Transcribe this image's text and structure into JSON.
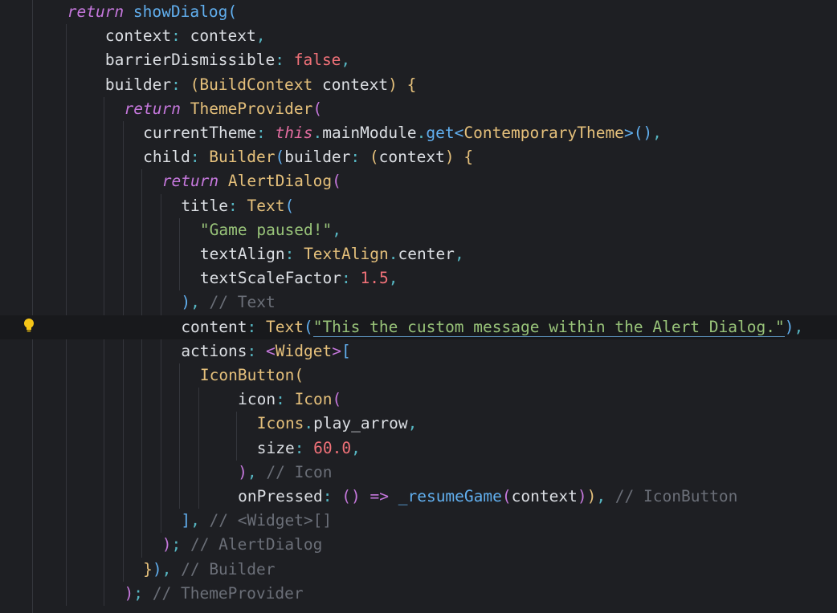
{
  "editor": {
    "language": "dart",
    "theme_bg": "#1e1f23",
    "current_line": 14,
    "lightbulb_icon": "lightbulb-icon",
    "lines": [
      {
        "indent": 2.7,
        "tokens": [
          [
            "kw",
            "return"
          ],
          [
            "sp",
            " "
          ],
          [
            "fn",
            "showDialog"
          ],
          [
            "b3",
            "("
          ]
        ]
      },
      {
        "indent": 4.7,
        "tokens": [
          [
            "prop",
            "context"
          ],
          [
            "p",
            ": "
          ],
          [
            "prop",
            "context"
          ],
          [
            "p",
            ","
          ]
        ]
      },
      {
        "indent": 4.7,
        "tokens": [
          [
            "prop",
            "barrierDismissible"
          ],
          [
            "p",
            ": "
          ],
          [
            "bool",
            "false"
          ],
          [
            "p",
            ","
          ]
        ]
      },
      {
        "indent": 4.7,
        "tokens": [
          [
            "prop",
            "builder"
          ],
          [
            "p",
            ": "
          ],
          [
            "b1",
            "("
          ],
          [
            "cls",
            "BuildContext"
          ],
          [
            "sp",
            " "
          ],
          [
            "prop",
            "context"
          ],
          [
            "b1",
            ")"
          ],
          [
            "sp",
            " "
          ],
          [
            "b1",
            "{"
          ]
        ]
      },
      {
        "indent": 5.7,
        "tokens": [
          [
            "kw",
            "return"
          ],
          [
            "sp",
            " "
          ],
          [
            "cls",
            "ThemeProvider"
          ],
          [
            "b2",
            "("
          ]
        ]
      },
      {
        "indent": 6.7,
        "tokens": [
          [
            "prop",
            "currentTheme"
          ],
          [
            "p",
            ": "
          ],
          [
            "this",
            "this"
          ],
          [
            "p",
            "."
          ],
          [
            "prop",
            "mainModule"
          ],
          [
            "p",
            "."
          ],
          [
            "fn",
            "get"
          ],
          [
            "b3",
            "<"
          ],
          [
            "cls",
            "ContemporaryTheme"
          ],
          [
            "b3",
            ">"
          ],
          [
            "b3",
            "()"
          ],
          [
            "p",
            ","
          ]
        ]
      },
      {
        "indent": 6.7,
        "tokens": [
          [
            "prop",
            "child"
          ],
          [
            "p",
            ": "
          ],
          [
            "cls",
            "Builder"
          ],
          [
            "b3",
            "("
          ],
          [
            "prop",
            "builder"
          ],
          [
            "p",
            ": "
          ],
          [
            "b1",
            "("
          ],
          [
            "prop",
            "context"
          ],
          [
            "b1",
            ")"
          ],
          [
            "sp",
            " "
          ],
          [
            "b1",
            "{"
          ]
        ]
      },
      {
        "indent": 7.7,
        "tokens": [
          [
            "kw",
            "return"
          ],
          [
            "sp",
            " "
          ],
          [
            "cls",
            "AlertDialog"
          ],
          [
            "b2",
            "("
          ]
        ]
      },
      {
        "indent": 8.7,
        "tokens": [
          [
            "prop",
            "title"
          ],
          [
            "p",
            ": "
          ],
          [
            "cls",
            "Text"
          ],
          [
            "b3",
            "("
          ]
        ]
      },
      {
        "indent": 9.7,
        "tokens": [
          [
            "str",
            "\"Game paused!\""
          ],
          [
            "p",
            ","
          ]
        ]
      },
      {
        "indent": 9.7,
        "tokens": [
          [
            "prop",
            "textAlign"
          ],
          [
            "p",
            ": "
          ],
          [
            "cls",
            "TextAlign"
          ],
          [
            "p",
            "."
          ],
          [
            "prop",
            "center"
          ],
          [
            "p",
            ","
          ]
        ]
      },
      {
        "indent": 9.7,
        "tokens": [
          [
            "prop",
            "textScaleFactor"
          ],
          [
            "p",
            ": "
          ],
          [
            "num",
            "1.5"
          ],
          [
            "p",
            ","
          ]
        ]
      },
      {
        "indent": 8.7,
        "tokens": [
          [
            "b3",
            ")"
          ],
          [
            "p",
            ", "
          ],
          [
            "cm",
            "// Text"
          ]
        ]
      },
      {
        "indent": 8.7,
        "tokens": [
          [
            "prop",
            "content"
          ],
          [
            "p",
            ": "
          ],
          [
            "cls",
            "Text"
          ],
          [
            "b3",
            "("
          ],
          [
            "strU",
            "\"This the custom message within the Alert Dialog.\""
          ],
          [
            "b3",
            ")"
          ],
          [
            "p",
            ","
          ]
        ]
      },
      {
        "indent": 8.7,
        "tokens": [
          [
            "prop",
            "actions"
          ],
          [
            "p",
            ": "
          ],
          [
            "b2",
            "<"
          ],
          [
            "cls",
            "Widget"
          ],
          [
            "b2",
            ">"
          ],
          [
            "b3",
            "["
          ]
        ]
      },
      {
        "indent": 9.7,
        "tokens": [
          [
            "cls",
            "IconButton"
          ],
          [
            "b1",
            "("
          ]
        ]
      },
      {
        "indent": 11.7,
        "tokens": [
          [
            "prop",
            "icon"
          ],
          [
            "p",
            ": "
          ],
          [
            "cls",
            "Icon"
          ],
          [
            "b2",
            "("
          ]
        ]
      },
      {
        "indent": 12.7,
        "tokens": [
          [
            "cls",
            "Icons"
          ],
          [
            "p",
            "."
          ],
          [
            "prop",
            "play_arrow"
          ],
          [
            "p",
            ","
          ]
        ]
      },
      {
        "indent": 12.7,
        "tokens": [
          [
            "prop",
            "size"
          ],
          [
            "p",
            ": "
          ],
          [
            "num",
            "60.0"
          ],
          [
            "p",
            ","
          ]
        ]
      },
      {
        "indent": 11.7,
        "tokens": [
          [
            "b2",
            ")"
          ],
          [
            "p",
            ", "
          ],
          [
            "cm",
            "// Icon"
          ]
        ]
      },
      {
        "indent": 11.7,
        "tokens": [
          [
            "prop",
            "onPressed"
          ],
          [
            "p",
            ": "
          ],
          [
            "b2",
            "()"
          ],
          [
            "sp",
            " "
          ],
          [
            "b2",
            "=>"
          ],
          [
            "sp",
            " "
          ],
          [
            "fn",
            "_resumeGame"
          ],
          [
            "b2",
            "("
          ],
          [
            "prop",
            "context"
          ],
          [
            "b2",
            ")"
          ],
          [
            "b1",
            ")"
          ],
          [
            "p",
            ", "
          ],
          [
            "cm",
            "// IconButton"
          ]
        ]
      },
      {
        "indent": 8.7,
        "tokens": [
          [
            "b3",
            "]"
          ],
          [
            "p",
            ", "
          ],
          [
            "cm",
            "// <Widget>[]"
          ]
        ]
      },
      {
        "indent": 7.7,
        "tokens": [
          [
            "b2",
            ")"
          ],
          [
            "p",
            "; "
          ],
          [
            "cm",
            "// AlertDialog"
          ]
        ]
      },
      {
        "indent": 6.7,
        "tokens": [
          [
            "b1",
            "}"
          ],
          [
            "b3",
            ")"
          ],
          [
            "p",
            ", "
          ],
          [
            "cm",
            "// Builder"
          ]
        ]
      },
      {
        "indent": 5.7,
        "tokens": [
          [
            "b2",
            ")"
          ],
          [
            "p",
            "; "
          ],
          [
            "cm",
            "// ThemeProvider"
          ]
        ]
      }
    ]
  }
}
